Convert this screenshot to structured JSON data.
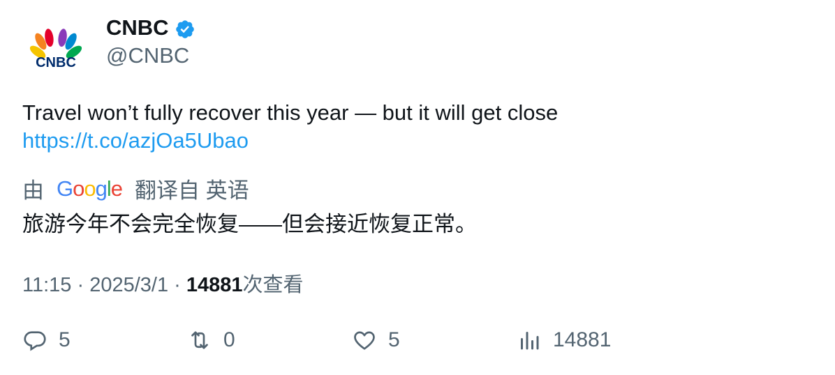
{
  "author": {
    "display_name": "CNBC",
    "handle": "@CNBC",
    "verified_icon": "verified-badge-icon",
    "avatar_icon": "cnbc-peacock-logo"
  },
  "tweet": {
    "text": "Travel won’t fully recover this year — but it will get close",
    "link": "https://t.co/azjOa5Ubao"
  },
  "translation": {
    "prefix": "由",
    "provider": "Google",
    "suffix": "翻译自 英语",
    "text": "旅游今年不会完全恢复——但会接近恢复正常。"
  },
  "meta": {
    "time": "11:15",
    "date": "2025/3/1",
    "views": "14881",
    "views_label": "次查看"
  },
  "actions": {
    "replies": "5",
    "retweets": "0",
    "likes": "5",
    "views": "14881"
  },
  "colors": {
    "link": "#1d9bf0",
    "muted": "#536471",
    "text": "#0f1419"
  }
}
